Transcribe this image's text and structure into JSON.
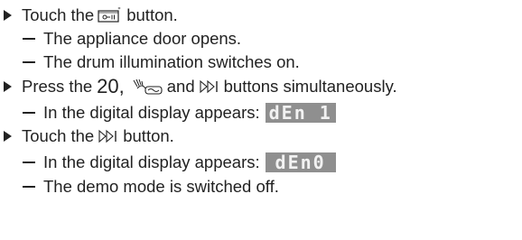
{
  "steps": [
    {
      "text_before": "Touch the",
      "text_after": "button.",
      "icon": "door-open-icon",
      "substeps": [
        "The appliance door opens.",
        "The drum illumination switches on."
      ]
    },
    {
      "text_before": "Press the",
      "number": "20,",
      "icon_1": "hand-wash-icon",
      "middle": "and",
      "icon_2": "skip-forward-icon",
      "text_after": "buttons simultaneously.",
      "substeps": [
        {
          "text": "In the digital display appears:",
          "display": "dEn 1"
        }
      ]
    },
    {
      "text_before": "Touch the",
      "icon": "skip-forward-icon",
      "text_after": "button.",
      "substeps": [
        {
          "text": "In the digital display appears:",
          "display": "dEn0"
        },
        "The demo mode is switched off."
      ]
    }
  ]
}
